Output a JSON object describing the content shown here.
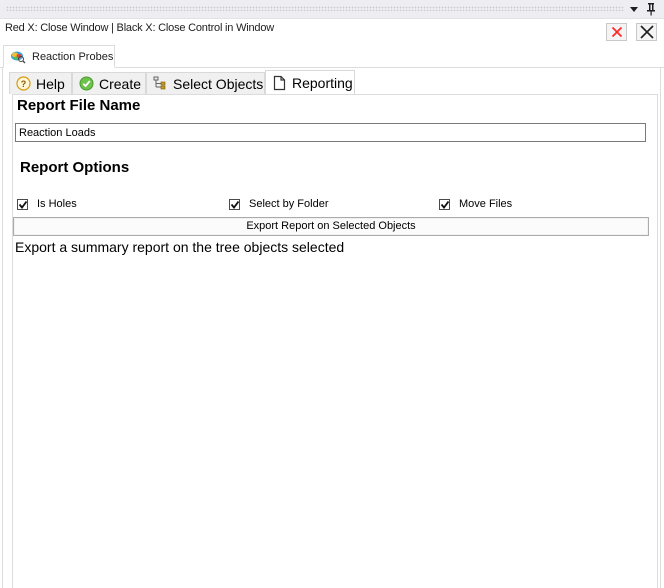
{
  "window": {
    "hint": "Red X: Close Window | Black X: Close Control in Window",
    "icons": {
      "dropdown": "triangle-down-icon",
      "pin": "pin-icon",
      "close_red": "red-x-icon",
      "close_black": "black-x-icon"
    },
    "accent_red": "#ff2a2a"
  },
  "outer_tab": {
    "label": "Reaction Probes",
    "icon": "reaction-probe-icon"
  },
  "tabs": [
    {
      "label": "Help",
      "icon": "question-circle-icon",
      "active": false
    },
    {
      "label": "Create",
      "icon": "check-circle-icon",
      "active": false
    },
    {
      "label": "Select Objects",
      "icon": "tree-select-icon",
      "active": false
    },
    {
      "label": "Reporting",
      "icon": "document-icon",
      "active": true
    }
  ],
  "reporting": {
    "file_name_title": "Report File Name",
    "file_name_value": "Reaction Loads",
    "options_title": "Report Options",
    "options": [
      {
        "label": "Is Holes",
        "checked": true
      },
      {
        "label": "Select by Folder",
        "checked": true
      },
      {
        "label": "Move Files",
        "checked": true
      }
    ],
    "export_button": "Export Report on Selected Objects",
    "description": "Export a summary report on the tree objects selected"
  }
}
